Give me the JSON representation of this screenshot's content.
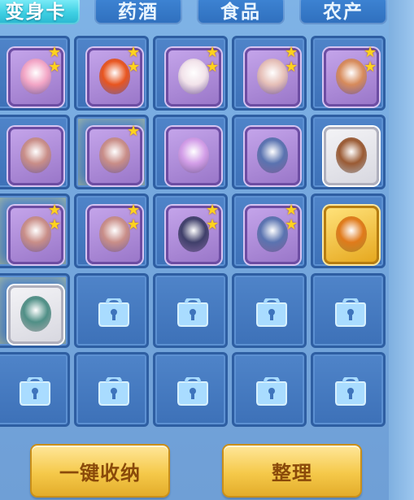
{
  "tabs": [
    {
      "label": "变身卡",
      "active": true
    },
    {
      "label": "药酒",
      "active": false
    },
    {
      "label": "食品",
      "active": false
    },
    {
      "label": "农产",
      "active": false
    }
  ],
  "grid": {
    "rows": [
      [
        {
          "item": "pink-pet-card",
          "stars": 2,
          "frame": "purple",
          "glow": false,
          "color": "#f3a6c6"
        },
        {
          "item": "fire-beast-card",
          "stars": 2,
          "frame": "purple",
          "glow": false,
          "color": "#e8551f"
        },
        {
          "item": "cow-pet-card",
          "stars": 2,
          "frame": "purple",
          "glow": false,
          "color": "#f2e3ea"
        },
        {
          "item": "pig-pet-card",
          "stars": 2,
          "frame": "purple",
          "glow": false,
          "color": "#e6c0b8"
        },
        {
          "item": "monkey-pet-card",
          "stars": 2,
          "frame": "purple",
          "glow": false,
          "color": "#d78b5b"
        }
      ],
      [
        {
          "item": "dancer-card",
          "stars": 0,
          "frame": "purple",
          "glow": false,
          "color": "#c98e88"
        },
        {
          "item": "dancer-card",
          "stars": 1,
          "frame": "purple",
          "glow": true,
          "color": "#c98e88"
        },
        {
          "item": "fairy-card",
          "stars": 0,
          "frame": "purple",
          "glow": false,
          "color": "#d39ee8"
        },
        {
          "item": "warrior-card",
          "stars": 0,
          "frame": "purple",
          "glow": false,
          "color": "#5a73b0"
        },
        {
          "item": "bear-card",
          "stars": 0,
          "frame": "white",
          "glow": false,
          "color": "#9a5a33"
        }
      ],
      [
        {
          "item": "dancer-card",
          "stars": 2,
          "frame": "purple",
          "glow": true,
          "color": "#c98e88"
        },
        {
          "item": "dancer-card",
          "stars": 2,
          "frame": "purple",
          "glow": false,
          "color": "#c98e88"
        },
        {
          "item": "swordsman-card",
          "stars": 2,
          "frame": "purple",
          "glow": false,
          "color": "#3f3f6a"
        },
        {
          "item": "warrior-card",
          "stars": 2,
          "frame": "purple",
          "glow": false,
          "color": "#5a73b0"
        },
        {
          "item": "golden-beast-card",
          "stars": 0,
          "frame": "gold",
          "glow": false,
          "color": "#e07a1a"
        }
      ],
      [
        {
          "item": "dragon-warrior-card",
          "stars": 0,
          "frame": "white",
          "glow": true,
          "color": "#4f8f86"
        },
        {
          "item": "locked",
          "stars": 0
        },
        {
          "item": "locked",
          "stars": 0
        },
        {
          "item": "locked",
          "stars": 0
        },
        {
          "item": "locked",
          "stars": 0
        }
      ],
      [
        {
          "item": "locked",
          "stars": 0
        },
        {
          "item": "locked",
          "stars": 0
        },
        {
          "item": "locked",
          "stars": 0
        },
        {
          "item": "locked",
          "stars": 0
        },
        {
          "item": "locked",
          "stars": 0
        }
      ]
    ]
  },
  "buttons": {
    "collect_all": "一键收纳",
    "sort": "整理"
  },
  "colors": {
    "panel_bg": "#76a8de",
    "slot_bg": "#4a7fc4",
    "star": "#ffd21e",
    "button_text": "#8a4a0a"
  }
}
